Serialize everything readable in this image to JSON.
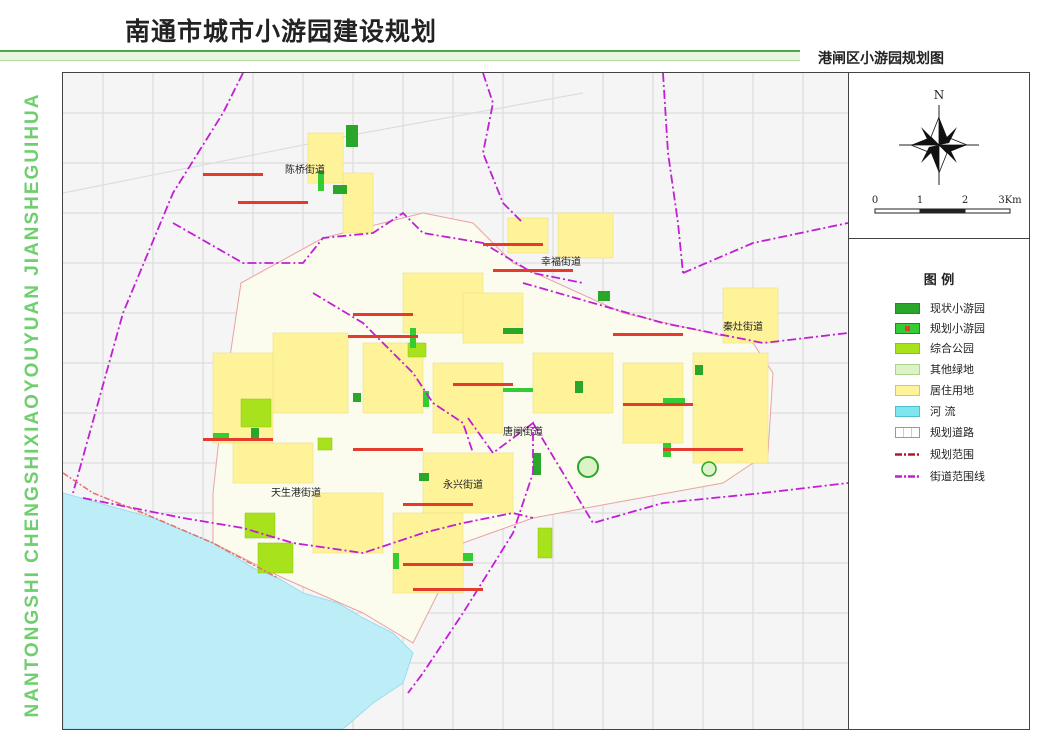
{
  "header": {
    "title": "南通市城市小游园建设规划",
    "subtitle": "港闸区小游园规划图",
    "side_text": "NANTONGSHI CHENGSHIXIAOYOUYUAN JIANSHEGUIHUA"
  },
  "compass": {
    "north_label": "N"
  },
  "scale_bar": {
    "ticks": [
      "0",
      "1",
      "2",
      "3Km"
    ]
  },
  "legend": {
    "title": "图 例",
    "items": [
      {
        "label": "现状小游园",
        "color": "#2aa62a"
      },
      {
        "label": "规划小游园",
        "color": "#33cc33"
      },
      {
        "label": "综合公园",
        "color": "#a7e21c"
      },
      {
        "label": "其他绿地",
        "color": "#dcf3c7"
      },
      {
        "label": "居住用地",
        "color": "#fff39a"
      },
      {
        "label": "河 流",
        "color": "#7fe6f0"
      },
      {
        "label": "规划道路",
        "color": "#ffffff"
      },
      {
        "label": "规划范围",
        "color": "#b2182b"
      },
      {
        "label": "街道范围线",
        "color": "#c21ed6"
      }
    ]
  },
  "streets": {
    "chenqiao": "陈桥街道",
    "xingfu": "幸福街道",
    "qinzao": "秦灶街道",
    "tangzha": "唐闸街道",
    "yongxing": "永兴街道",
    "tianshenggang": "天生港街道"
  },
  "colors": {
    "accent_green": "#4aa84a",
    "side_text": "#6fcf6f",
    "river": "#bdeef8",
    "planned_boundary": "#e1706d",
    "street_boundary": "#c21ed6",
    "road": "#d8d8d8",
    "map_bg": "#f2f2f2"
  }
}
